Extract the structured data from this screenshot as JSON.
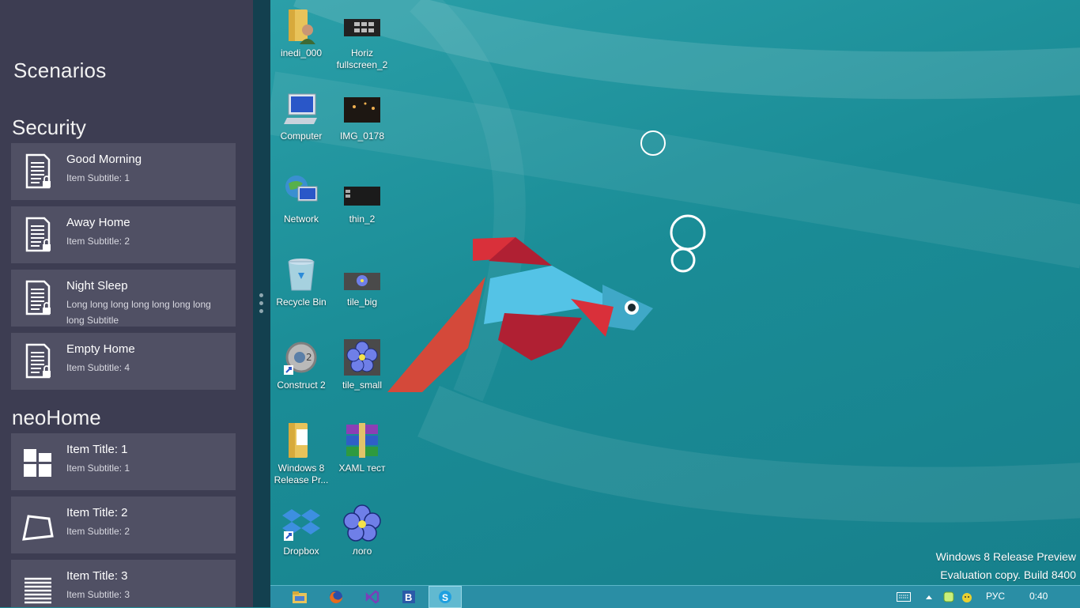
{
  "app": {
    "title": "Scenarios",
    "groups": [
      {
        "header": "Security",
        "items": [
          {
            "title": "Good Morning",
            "subtitle": "Item Subtitle: 1"
          },
          {
            "title": "Away Home",
            "subtitle": "Item Subtitle: 2"
          },
          {
            "title": "Night Sleep",
            "subtitle": "Long long long long long long long  long  Subtitle"
          },
          {
            "title": "Empty Home",
            "subtitle": "Item Subtitle: 4"
          }
        ]
      },
      {
        "header": "neoHome",
        "items": [
          {
            "title": "Item Title: 1",
            "subtitle": "Item Subtitle: 1"
          },
          {
            "title": "Item Title: 2",
            "subtitle": "Item Subtitle: 2"
          },
          {
            "title": "Item Title: 3",
            "subtitle": "Item Subtitle: 3"
          }
        ]
      }
    ]
  },
  "desktop": {
    "icons": [
      {
        "label": "inedi_000",
        "icon": "user-folder-icon"
      },
      {
        "label": "Horiz fullscreen_2",
        "icon": "image-thumbnail-icon"
      },
      {
        "label": "Computer",
        "icon": "computer-icon"
      },
      {
        "label": "IMG_0178",
        "icon": "photo-thumbnail-icon"
      },
      {
        "label": "Network",
        "icon": "network-icon"
      },
      {
        "label": "thin_2",
        "icon": "image-thumbnail-icon"
      },
      {
        "label": "Recycle Bin",
        "icon": "recycle-bin-icon"
      },
      {
        "label": "tile_big",
        "icon": "image-thumbnail-icon"
      },
      {
        "label": "Construct 2",
        "icon": "construct-shortcut-icon"
      },
      {
        "label": "tile_small",
        "icon": "flower-tile-icon"
      },
      {
        "label": "Windows 8 Release Pr...",
        "icon": "folder-icon"
      },
      {
        "label": "XAML тест",
        "icon": "winrar-archive-icon"
      },
      {
        "label": "Dropbox",
        "icon": "dropbox-shortcut-icon"
      },
      {
        "label": "лого",
        "icon": "flower-logo-icon"
      }
    ],
    "watermark": {
      "line1": "Windows 8 Release Preview",
      "line2": "Evaluation copy. Build 8400"
    }
  },
  "taskbar": {
    "apps": [
      "explorer-icon",
      "firefox-icon",
      "visual-studio-icon",
      "blend-icon",
      "skype-icon"
    ],
    "language": "РУС",
    "time": "0:40"
  },
  "colors": {
    "app_bg": "#3d3d52",
    "tile_bg": "#505064",
    "desktop_bg": "#1e8f99",
    "taskbar_bg": "#2a8ea5"
  }
}
